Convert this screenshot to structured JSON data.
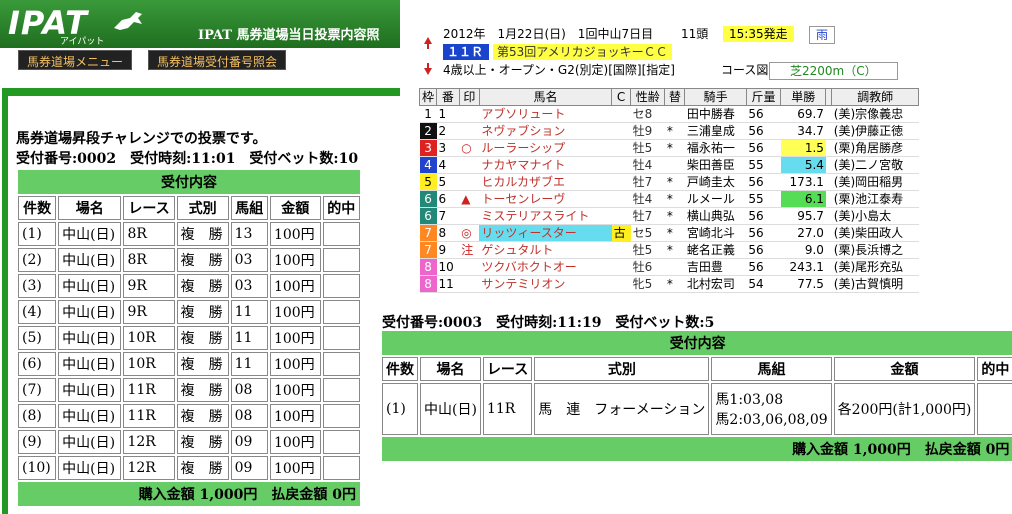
{
  "header": {
    "logo": "IPAT",
    "logo_sub": "アイパット",
    "title": "IPAT 馬券道場当日投票内容照",
    "menu": [
      "馬券道場メニュー",
      "馬券道場受付番号照会"
    ]
  },
  "left": {
    "intro": "馬券道場昇段チャレンジでの投票です。",
    "receipt_line": "受付番号:0002　受付時刻:11:01　受付ベット数:10",
    "table_title": "受付内容",
    "cols": [
      "件数",
      "場名",
      "レース",
      "式別",
      "馬組",
      "金額",
      "的中"
    ],
    "rows": [
      [
        "(1)",
        "中山(日)",
        "8R",
        "複　勝",
        "13",
        "100円",
        ""
      ],
      [
        "(2)",
        "中山(日)",
        "8R",
        "複　勝",
        "03",
        "100円",
        ""
      ],
      [
        "(3)",
        "中山(日)",
        "9R",
        "複　勝",
        "03",
        "100円",
        ""
      ],
      [
        "(4)",
        "中山(日)",
        "9R",
        "複　勝",
        "11",
        "100円",
        ""
      ],
      [
        "(5)",
        "中山(日)",
        "10R",
        "複　勝",
        "11",
        "100円",
        ""
      ],
      [
        "(6)",
        "中山(日)",
        "10R",
        "複　勝",
        "11",
        "100円",
        ""
      ],
      [
        "(7)",
        "中山(日)",
        "11R",
        "複　勝",
        "08",
        "100円",
        ""
      ],
      [
        "(8)",
        "中山(日)",
        "11R",
        "複　勝",
        "08",
        "100円",
        ""
      ],
      [
        "(9)",
        "中山(日)",
        "12R",
        "複　勝",
        "09",
        "100円",
        ""
      ],
      [
        "(10)",
        "中山(日)",
        "12R",
        "複　勝",
        "09",
        "100円",
        ""
      ]
    ],
    "footer": "購入金額 1,000円　払戻金額 0円"
  },
  "right": {
    "receipt_line": "受付番号:0003　受付時刻:11:19　受付ベット数:5",
    "table_title": "受付内容",
    "cols": [
      "件数",
      "場名",
      "レース",
      "式別",
      "馬組",
      "金額",
      "的中"
    ],
    "row": {
      "no": "(1)",
      "place": "中山(日)",
      "race": "11R",
      "type": "馬　連　フォーメーション",
      "combo1": "馬1:03,08",
      "combo2": "馬2:03,06,08,09",
      "amount": "各200円(計1,000円)",
      "hit": ""
    },
    "footer": "購入金額 1,000円　払戻金額 0円"
  },
  "race": {
    "date": "2012年　1月22日(日)　1回中山7日目",
    "heads": "11頭",
    "post_time": "15:35発走",
    "weather": "雨",
    "race_no": "１１Ｒ",
    "race_name": "第53回アメリカジョッキーＣＣ",
    "conditions": "4歳以上・オープン・G2(別定)[国際][指定]",
    "course_label": "コース図",
    "course": "芝2200m（C）",
    "cols": [
      "枠",
      "番",
      "印",
      "馬名",
      "C",
      "性齢",
      "替",
      "騎手",
      "斤量",
      "単勝",
      "",
      "調教師"
    ],
    "horses": [
      {
        "waku": "1",
        "wc": "#ffffff",
        "wt": "#000",
        "no": "1",
        "mark": "",
        "name": "アブソリュート",
        "sex": "セ8",
        "alt": "",
        "jockey": "田中勝春",
        "kg": "56",
        "odds": "69.7",
        "oc": "",
        "trainer": "(美)宗像義忠"
      },
      {
        "waku": "2",
        "wc": "#111111",
        "wt": "#fff",
        "no": "2",
        "mark": "",
        "name": "ネヴァブション",
        "sex": "牡9",
        "alt": "*",
        "jockey": "三浦皇成",
        "kg": "56",
        "odds": "34.7",
        "oc": "",
        "trainer": "(美)伊藤正徳"
      },
      {
        "waku": "3",
        "wc": "#dd2222",
        "wt": "#fff",
        "no": "3",
        "mark": "○",
        "name": "ルーラーシップ",
        "sex": "牡5",
        "alt": "*",
        "jockey": "福永祐一",
        "kg": "56",
        "odds": "1.5",
        "oc": "oddsY",
        "trainer": "(栗)角居勝彦"
      },
      {
        "waku": "4",
        "wc": "#2244cc",
        "wt": "#fff",
        "no": "4",
        "mark": "",
        "name": "ナカヤマナイト",
        "sex": "牡4",
        "alt": "",
        "jockey": "柴田善臣",
        "kg": "55",
        "odds": "5.4",
        "oc": "oddsC",
        "trainer": "(美)二ノ宮敬"
      },
      {
        "waku": "5",
        "wc": "#ffee22",
        "wt": "#000",
        "no": "5",
        "mark": "",
        "name": "ヒカルカザブエ",
        "sex": "牡7",
        "alt": "*",
        "jockey": "戸崎圭太",
        "kg": "56",
        "odds": "173.1",
        "oc": "",
        "trainer": "(美)岡田稲男"
      },
      {
        "waku": "6",
        "wc": "#228877",
        "wt": "#fff",
        "no": "6",
        "mark": "▲",
        "name": "トーセンレーヴ",
        "sex": "牡4",
        "alt": "*",
        "jockey": "ルメール",
        "kg": "55",
        "odds": "6.1",
        "oc": "oddsG",
        "trainer": "(栗)池江泰寿"
      },
      {
        "waku": "6",
        "wc": "#228877",
        "wt": "#fff",
        "no": "7",
        "mark": "",
        "name": "ミステリアスライト",
        "sex": "牡7",
        "alt": "*",
        "jockey": "横山典弘",
        "kg": "56",
        "odds": "95.7",
        "oc": "",
        "trainer": "(美)小島太"
      },
      {
        "waku": "7",
        "wc": "#ff8822",
        "wt": "#fff",
        "no": "8",
        "mark": "◎",
        "name": "リッツィースター",
        "sex": "セ5",
        "alt": "*",
        "jockey": "宮崎北斗",
        "kg": "56",
        "odds": "27.0",
        "oc": "",
        "trainer": "(美)柴田政人",
        "ko": "古"
      },
      {
        "waku": "7",
        "wc": "#ff8822",
        "wt": "#fff",
        "no": "9",
        "mark": "注",
        "name": "ゲシュタルト",
        "sex": "牡5",
        "alt": "*",
        "jockey": "蛯名正義",
        "kg": "56",
        "odds": "9.0",
        "oc": "",
        "trainer": "(栗)長浜博之"
      },
      {
        "waku": "8",
        "wc": "#ee66cc",
        "wt": "#fff",
        "no": "10",
        "mark": "",
        "name": "ツクバホクトオー",
        "sex": "牡6",
        "alt": "",
        "jockey": "吉田豊",
        "kg": "56",
        "odds": "243.1",
        "oc": "",
        "trainer": "(美)尾形充弘"
      },
      {
        "waku": "8",
        "wc": "#ee66cc",
        "wt": "#fff",
        "no": "11",
        "mark": "",
        "name": "サンテミリオン",
        "sex": "牝5",
        "alt": "*",
        "jockey": "北村宏司",
        "kg": "54",
        "odds": "77.5",
        "oc": "",
        "trainer": "(美)古賀慎明"
      }
    ]
  }
}
